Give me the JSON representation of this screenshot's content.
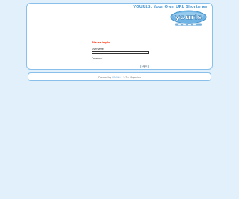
{
  "header": {
    "tagline": "YOURLS: Your Own URL Shortener",
    "logo_text": "yourls"
  },
  "login": {
    "error_message": "Please log in",
    "username_label": "Username",
    "username_value": "",
    "password_label": "Password",
    "password_value": "",
    "submit_label": "Login"
  },
  "footer": {
    "prefix": "Powered by",
    "link_text": "YOURLS",
    "version_text": "v 1.7 — 0 queries"
  },
  "colors": {
    "page_background": "#e1f0fa",
    "border": "#88c0eb",
    "accent": "#5aa0d6",
    "error": "#ff2a00"
  }
}
